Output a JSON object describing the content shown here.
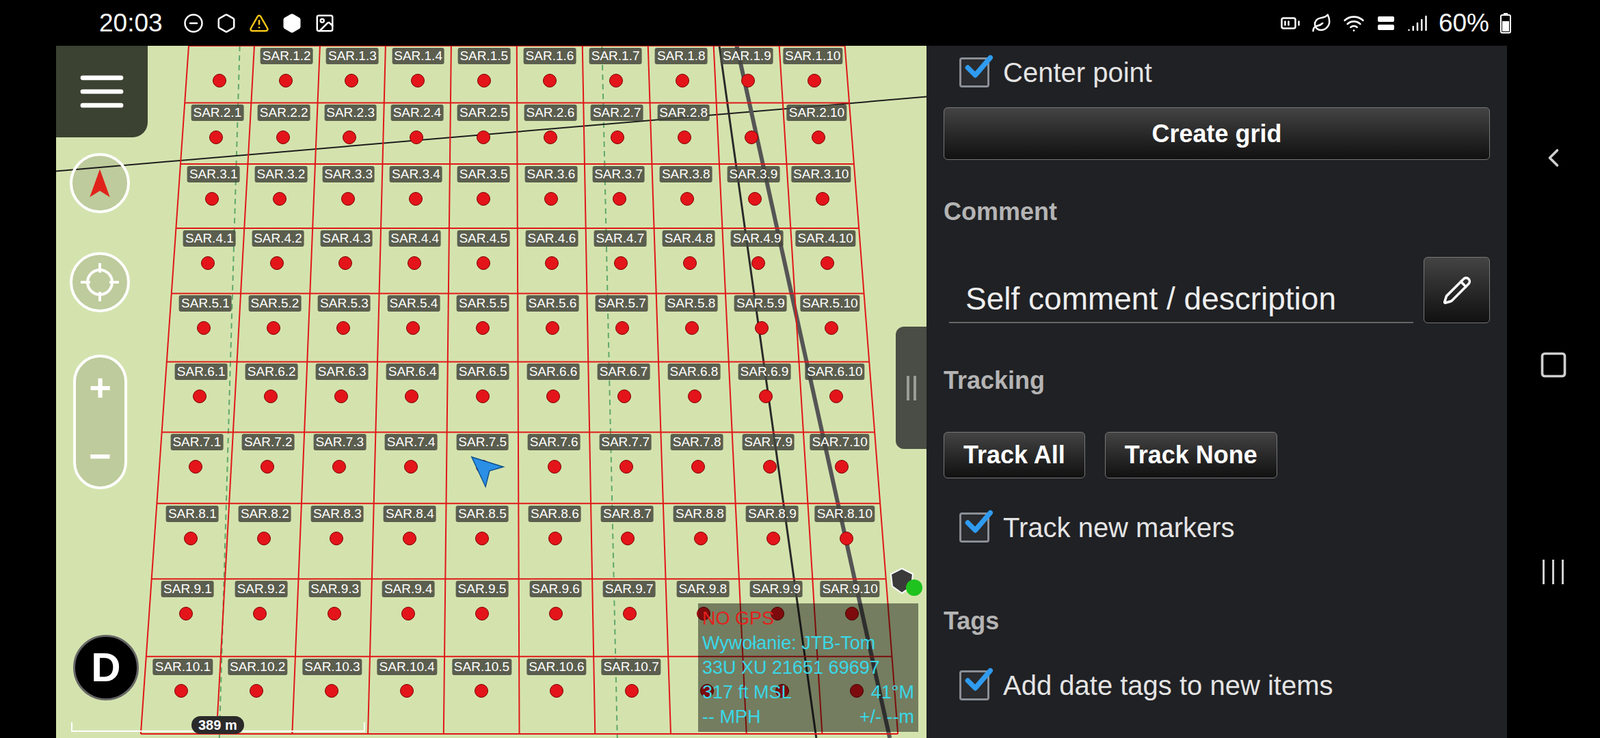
{
  "status_bar": {
    "time": "20:03",
    "battery": "60%"
  },
  "map": {
    "zoom": {
      "in": "+",
      "out": "−"
    },
    "logo": "D",
    "scale": "389 m",
    "info": {
      "status": "NO GPS",
      "callsign": "Wywołanie: JTB-Tom",
      "coordinates": "33U XU 21651 69697",
      "altitude": "317 ft MSL",
      "heading": "41°M",
      "speed": "-- MPH",
      "accuracy": "+/- --m"
    },
    "grid": {
      "rows": [
        [
          "",
          "SAR.1.2",
          "SAR.1.3",
          "SAR.1.4",
          "SAR.1.5",
          "SAR.1.6",
          "SAR.1.7",
          "SAR.1.8",
          "SAR.1.9",
          "SAR.1.10"
        ],
        [
          "SAR.2.1",
          "SAR.2.2",
          "SAR.2.3",
          "SAR.2.4",
          "SAR.2.5",
          "SAR.2.6",
          "SAR.2.7",
          "SAR.2.8",
          "",
          "SAR.2.10"
        ],
        [
          "SAR.3.1",
          "SAR.3.2",
          "SAR.3.3",
          "SAR.3.4",
          "SAR.3.5",
          "SAR.3.6",
          "SAR.3.7",
          "SAR.3.8",
          "SAR.3.9",
          "SAR.3.10"
        ],
        [
          "SAR.4.1",
          "SAR.4.2",
          "SAR.4.3",
          "SAR.4.4",
          "SAR.4.5",
          "SAR.4.6",
          "SAR.4.7",
          "SAR.4.8",
          "SAR.4.9",
          "SAR.4.10"
        ],
        [
          "SAR.5.1",
          "SAR.5.2",
          "SAR.5.3",
          "SAR.5.4",
          "SAR.5.5",
          "SAR.5.6",
          "SAR.5.7",
          "SAR.5.8",
          "SAR.5.9",
          "SAR.5.10"
        ],
        [
          "SAR.6.1",
          "SAR.6.2",
          "SAR.6.3",
          "SAR.6.4",
          "SAR.6.5",
          "SAR.6.6",
          "SAR.6.7",
          "SAR.6.8",
          "SAR.6.9",
          "SAR.6.10"
        ],
        [
          "SAR.7.1",
          "SAR.7.2",
          "SAR.7.3",
          "SAR.7.4",
          "SAR.7.5",
          "SAR.7.6",
          "SAR.7.7",
          "SAR.7.8",
          "SAR.7.9",
          "SAR.7.10"
        ],
        [
          "SAR.8.1",
          "SAR.8.2",
          "SAR.8.3",
          "SAR.8.4",
          "SAR.8.5",
          "SAR.8.6",
          "SAR.8.7",
          "SAR.8.8",
          "SAR.8.9",
          "SAR.8.10"
        ],
        [
          "SAR.9.1",
          "SAR.9.2",
          "SAR.9.3",
          "SAR.9.4",
          "SAR.9.5",
          "SAR.9.6",
          "SAR.9.7",
          "SAR.9.8",
          "SAR.9.9",
          "SAR.9.10"
        ],
        [
          "SAR.10.1",
          "SAR.10.2",
          "SAR.10.3",
          "SAR.10.4",
          "SAR.10.5",
          "SAR.10.6",
          "SAR.10.7",
          "",
          "",
          ""
        ]
      ]
    }
  },
  "panel": {
    "center_point": {
      "label": "Center point",
      "checked": true
    },
    "create_grid": "Create grid",
    "comment": {
      "heading": "Comment",
      "value": "Self comment / description"
    },
    "tracking": {
      "heading": "Tracking",
      "buttons": [
        "Track All",
        "Track None"
      ],
      "track_new": {
        "label": "Track new markers",
        "checked": true
      }
    },
    "tags": {
      "heading": "Tags",
      "add_date": {
        "label": "Add date tags to new items",
        "checked": true
      }
    }
  }
}
